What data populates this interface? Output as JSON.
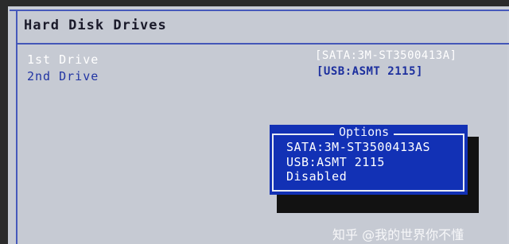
{
  "page": {
    "title": "Hard Disk Drives"
  },
  "drives": [
    {
      "label": "1st Drive",
      "value": "[SATA:3M-ST3500413A]"
    },
    {
      "label": "2nd Drive",
      "value": "[USB:ASMT 2115]"
    }
  ],
  "options_popup": {
    "title": "Options",
    "items": [
      "SATA:3M-ST3500413AS",
      "USB:ASMT 2115",
      "Disabled"
    ]
  },
  "watermark": "知乎 @我的世界你不懂",
  "colors": {
    "background": "#c9cdd6",
    "accent_blue": "#1231b5",
    "selected_text": "#ffffff",
    "normal_text": "#2235a3"
  }
}
